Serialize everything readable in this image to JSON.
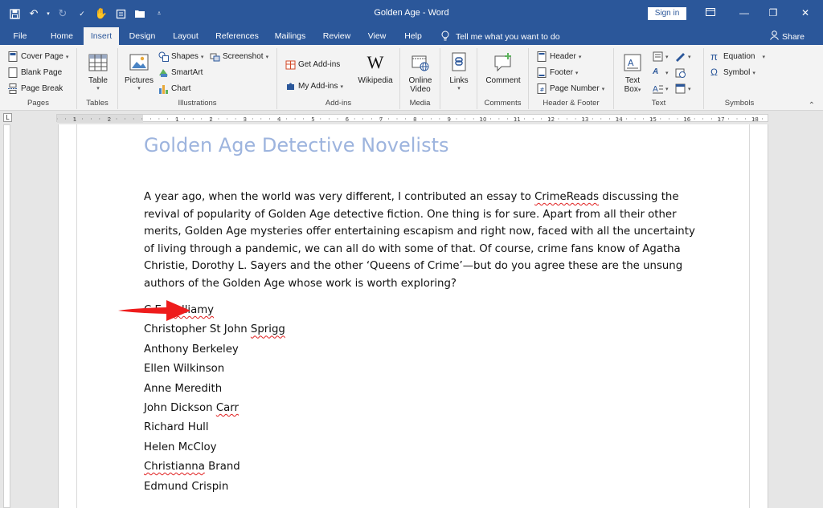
{
  "window": {
    "title": "Golden Age - Word",
    "sign_in": "Sign in",
    "share": "Share",
    "tell_me": "Tell me what you want to do"
  },
  "tabs": [
    "File",
    "Home",
    "Insert",
    "Design",
    "Layout",
    "References",
    "Mailings",
    "Review",
    "View",
    "Help"
  ],
  "active_tab": "Insert",
  "ribbon": {
    "pages": {
      "label": "Pages",
      "cover_page": "Cover Page",
      "blank_page": "Blank Page",
      "page_break": "Page Break"
    },
    "tables": {
      "label": "Tables",
      "table": "Table"
    },
    "illustrations": {
      "label": "Illustrations",
      "pictures": "Pictures",
      "shapes": "Shapes",
      "smartart": "SmartArt",
      "chart": "Chart",
      "screenshot": "Screenshot"
    },
    "addins": {
      "label": "Add-ins",
      "get_addins": "Get Add-ins",
      "my_addins": "My Add-ins",
      "wikipedia": "Wikipedia"
    },
    "media": {
      "label": "Media",
      "online_video_1": "Online",
      "online_video_2": "Video"
    },
    "links": {
      "label": "Links"
    },
    "comments": {
      "label": "Comments",
      "comment": "Comment"
    },
    "header_footer": {
      "label": "Header & Footer",
      "header": "Header",
      "footer": "Footer",
      "page_number": "Page Number"
    },
    "text": {
      "label": "Text",
      "text_box_1": "Text",
      "text_box_2": "Box"
    },
    "symbols": {
      "label": "Symbols",
      "equation": "Equation",
      "symbol": "Symbol"
    }
  },
  "document": {
    "title": "Golden Age Detective Novelists",
    "paragraph": {
      "part1": "A year ago, when the world was very different, I contributed an essay to ",
      "crimereads": "CrimeReads",
      "part2": " discussing the revival of popularity of Golden Age detective fiction. One thing is for sure. Apart from all their other merits, Golden Age mysteries offer entertaining escapism and right now, faced with all the uncertainty of living through a pandemic, we can all do with some of that. Of course, crime fans know of Agatha Christie, Dorothy L. Sayers and the other ‘Queens of Crime’—but do you agree these are the unsung authors of the Golden Age whose work is worth exploring?"
    },
    "names": [
      {
        "plain": "C.E. ",
        "flagged": "Vulliamy",
        "after": ""
      },
      {
        "plain": "Christopher St John ",
        "flagged": "Sprigg",
        "after": ""
      },
      {
        "plain": "Anthony Berkeley",
        "flagged": "",
        "after": ""
      },
      {
        "plain": "Ellen Wilkinson",
        "flagged": "",
        "after": ""
      },
      {
        "plain": "Anne Meredith",
        "flagged": "",
        "after": ""
      },
      {
        "plain": "John Dickson ",
        "flagged": "Carr",
        "after": ""
      },
      {
        "plain": "Richard Hull",
        "flagged": "",
        "after": ""
      },
      {
        "plain": "Helen McCloy",
        "flagged": "",
        "after": ""
      },
      {
        "plain": "",
        "flagged": "Christianna",
        "after": " Brand"
      },
      {
        "plain": "Edmund Crispin",
        "flagged": "",
        "after": ""
      }
    ]
  },
  "ruler_numbers": [
    "1",
    "2",
    "1",
    "2",
    "3",
    "4",
    "5",
    "6",
    "7",
    "8",
    "9",
    "10",
    "11",
    "12",
    "13",
    "14",
    "15",
    "16",
    "17",
    "18"
  ],
  "colors": {
    "brand": "#2b579a",
    "title_text": "#9db4de",
    "arrow": "#ee1c1c",
    "spell_underline": "#e02020"
  }
}
